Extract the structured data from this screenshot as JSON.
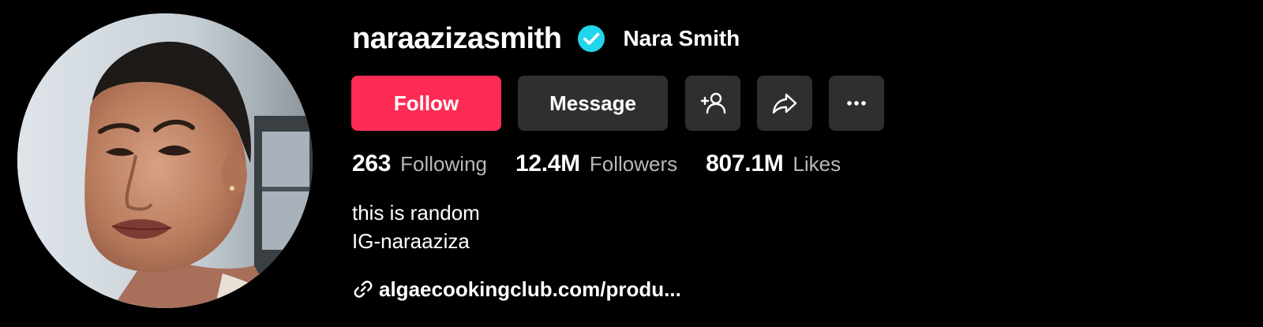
{
  "profile": {
    "username": "naraazizasmith",
    "display_name": "Nara Smith",
    "verified_icon": "verified-badge-icon",
    "verified_color": "#20d5ec"
  },
  "actions": {
    "follow_label": "Follow",
    "follow_color": "#fe2c55",
    "message_label": "Message",
    "add_friend_icon": "add-friend-icon",
    "share_icon": "share-icon",
    "more_icon": "more-icon"
  },
  "stats": {
    "following_value": "263",
    "following_label": "Following",
    "followers_value": "12.4M",
    "followers_label": "Followers",
    "likes_value": "807.1M",
    "likes_label": "Likes"
  },
  "bio": {
    "line1": "this is random",
    "line2": "IG-naraaziza"
  },
  "link": {
    "icon": "link-icon",
    "text": "algaecookingclub.com/produ..."
  }
}
